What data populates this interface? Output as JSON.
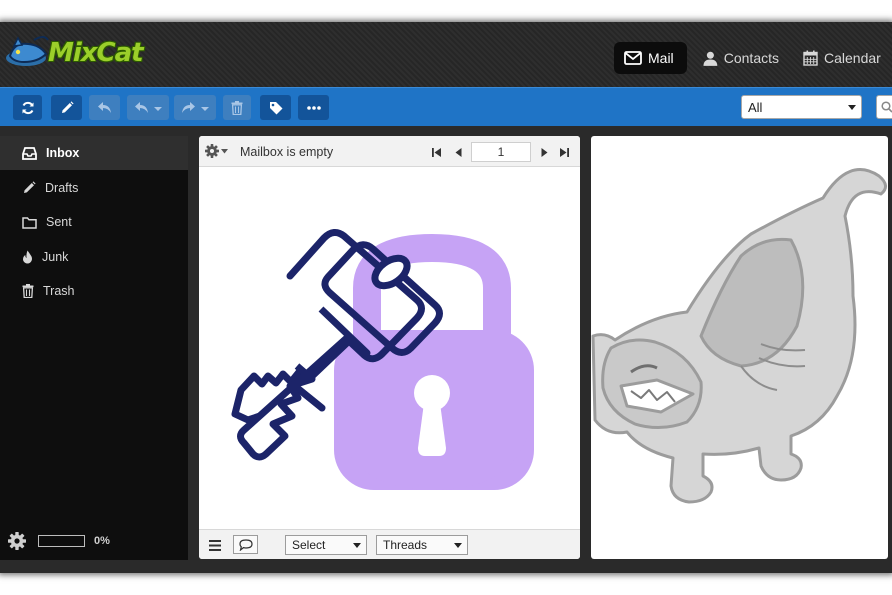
{
  "header": {
    "logo_text": "MixCat",
    "nav": [
      {
        "label": "Mail",
        "icon": "envelope-icon",
        "active": true
      },
      {
        "label": "Contacts",
        "icon": "user-icon",
        "active": false
      },
      {
        "label": "Calendar",
        "icon": "calendar-icon",
        "active": false
      }
    ]
  },
  "toolbar": {
    "buttons": [
      {
        "name": "refresh-button",
        "icon": "refresh-icon",
        "enabled": true
      },
      {
        "name": "compose-button",
        "icon": "pencil-icon",
        "enabled": true
      },
      {
        "name": "reply-button",
        "icon": "reply-icon",
        "enabled": false
      },
      {
        "name": "reply-all-button",
        "icon": "reply-all-icon",
        "enabled": false
      },
      {
        "name": "forward-button",
        "icon": "forward-icon",
        "enabled": false
      },
      {
        "name": "delete-button",
        "icon": "trash-icon",
        "enabled": false
      },
      {
        "name": "tag-button",
        "icon": "tag-icon",
        "enabled": true
      },
      {
        "name": "more-button",
        "icon": "ellipsis-icon",
        "enabled": true
      }
    ],
    "filter_value": "All"
  },
  "sidebar": {
    "folders": [
      {
        "label": "Inbox",
        "icon": "inbox-icon",
        "selected": true
      },
      {
        "label": "Drafts",
        "icon": "pencil-icon",
        "selected": false
      },
      {
        "label": "Sent",
        "icon": "folder-icon",
        "selected": false
      },
      {
        "label": "Junk",
        "icon": "fire-icon",
        "selected": false
      },
      {
        "label": "Trash",
        "icon": "trash-icon",
        "selected": false
      }
    ],
    "quota_text": "0%",
    "quota_fraction": 0
  },
  "message_list": {
    "status_text": "Mailbox is empty",
    "page_number": "1",
    "footer": {
      "select_label": "Select",
      "threads_label": "Threads"
    }
  },
  "colors": {
    "toolbar_blue": "#1f74c6",
    "button_dark_blue": "#13549a",
    "lock_purple": "#c6a3f5",
    "key_navy": "#1c2469"
  }
}
